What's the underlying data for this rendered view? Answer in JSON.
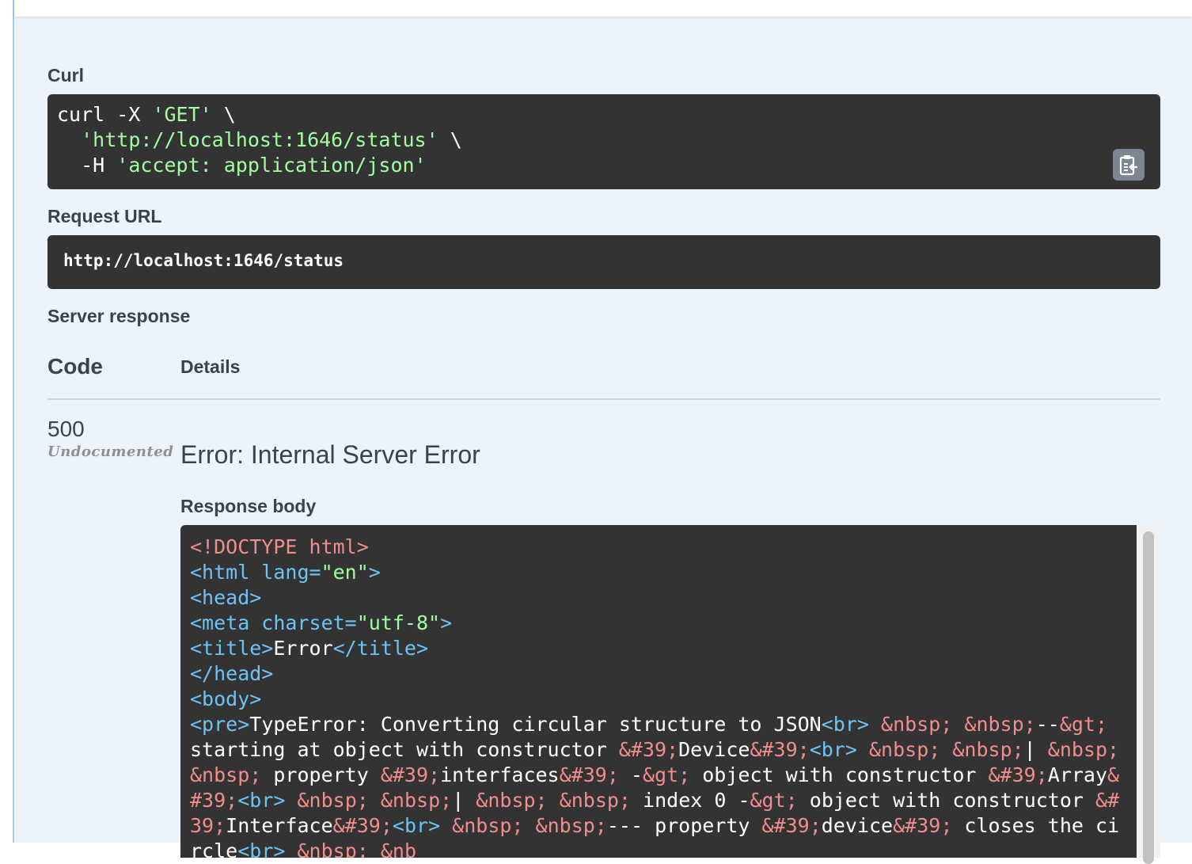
{
  "curl": {
    "label": "Curl",
    "line1_cmd": "curl -X ",
    "line1_method": "'GET'",
    "line1_tail": " \\",
    "line2_indent": "  ",
    "line2_url": "'http://localhost:1646/status'",
    "line2_tail": " \\",
    "line3_flag": "  -H ",
    "line3_header": "'accept: application/json'",
    "copy_icon": "copy-to-clipboard-icon"
  },
  "request_url": {
    "label": "Request URL",
    "value": "http://localhost:1646/status"
  },
  "server_response": {
    "label": "Server response",
    "col_code": "Code",
    "col_details": "Details",
    "code": "500",
    "code_note": "Undocumented",
    "error_title": "Error: Internal Server Error",
    "body_label": "Response body",
    "body_tokens": [
      {
        "k": "doc",
        "t": "<!DOCTYPE html>"
      },
      {
        "k": "txt",
        "t": "\n"
      },
      {
        "k": "tag",
        "t": "<html lang="
      },
      {
        "k": "str",
        "t": "\"en\""
      },
      {
        "k": "tag",
        "t": ">"
      },
      {
        "k": "txt",
        "t": "\n"
      },
      {
        "k": "tag",
        "t": "<head>"
      },
      {
        "k": "txt",
        "t": "\n"
      },
      {
        "k": "tag",
        "t": "<meta charset="
      },
      {
        "k": "str",
        "t": "\"utf-8\""
      },
      {
        "k": "tag",
        "t": ">"
      },
      {
        "k": "txt",
        "t": "\n"
      },
      {
        "k": "tag",
        "t": "<title>"
      },
      {
        "k": "txt",
        "t": "Error"
      },
      {
        "k": "tag",
        "t": "</title>"
      },
      {
        "k": "txt",
        "t": "\n"
      },
      {
        "k": "tag",
        "t": "</head>"
      },
      {
        "k": "txt",
        "t": "\n"
      },
      {
        "k": "tag",
        "t": "<body>"
      },
      {
        "k": "txt",
        "t": "\n"
      },
      {
        "k": "tag",
        "t": "<pre>"
      },
      {
        "k": "txt",
        "t": "TypeError: Converting circular structure to JSON"
      },
      {
        "k": "tag",
        "t": "<br>"
      },
      {
        "k": "txt",
        "t": " "
      },
      {
        "k": "ent",
        "t": "&nbsp;"
      },
      {
        "k": "txt",
        "t": " "
      },
      {
        "k": "ent",
        "t": "&nbsp;"
      },
      {
        "k": "txt",
        "t": "--"
      },
      {
        "k": "ent",
        "t": "&gt;"
      },
      {
        "k": "txt",
        "t": " starting at object with constructor "
      },
      {
        "k": "ent",
        "t": "&#39;"
      },
      {
        "k": "txt",
        "t": "Device"
      },
      {
        "k": "ent",
        "t": "&#39;"
      },
      {
        "k": "tag",
        "t": "<br>"
      },
      {
        "k": "txt",
        "t": " "
      },
      {
        "k": "ent",
        "t": "&nbsp;"
      },
      {
        "k": "txt",
        "t": " "
      },
      {
        "k": "ent",
        "t": "&nbsp;"
      },
      {
        "k": "txt",
        "t": "| "
      },
      {
        "k": "ent",
        "t": "&nbsp;"
      },
      {
        "k": "txt",
        "t": " "
      },
      {
        "k": "ent",
        "t": "&nbsp;"
      },
      {
        "k": "txt",
        "t": " property "
      },
      {
        "k": "ent",
        "t": "&#39;"
      },
      {
        "k": "txt",
        "t": "interfaces"
      },
      {
        "k": "ent",
        "t": "&#39;"
      },
      {
        "k": "txt",
        "t": " -"
      },
      {
        "k": "ent",
        "t": "&gt;"
      },
      {
        "k": "txt",
        "t": " object with constructor "
      },
      {
        "k": "ent",
        "t": "&#39;"
      },
      {
        "k": "txt",
        "t": "Array"
      },
      {
        "k": "ent",
        "t": "&#39;"
      },
      {
        "k": "tag",
        "t": "<br>"
      },
      {
        "k": "txt",
        "t": " "
      },
      {
        "k": "ent",
        "t": "&nbsp;"
      },
      {
        "k": "txt",
        "t": " "
      },
      {
        "k": "ent",
        "t": "&nbsp;"
      },
      {
        "k": "txt",
        "t": "| "
      },
      {
        "k": "ent",
        "t": "&nbsp;"
      },
      {
        "k": "txt",
        "t": " "
      },
      {
        "k": "ent",
        "t": "&nbsp;"
      },
      {
        "k": "txt",
        "t": " index 0 -"
      },
      {
        "k": "ent",
        "t": "&gt;"
      },
      {
        "k": "txt",
        "t": " object with constructor "
      },
      {
        "k": "ent",
        "t": "&#39;"
      },
      {
        "k": "txt",
        "t": "Interface"
      },
      {
        "k": "ent",
        "t": "&#39;"
      },
      {
        "k": "tag",
        "t": "<br>"
      },
      {
        "k": "txt",
        "t": " "
      },
      {
        "k": "ent",
        "t": "&nbsp;"
      },
      {
        "k": "txt",
        "t": " "
      },
      {
        "k": "ent",
        "t": "&nbsp;"
      },
      {
        "k": "txt",
        "t": "--- property "
      },
      {
        "k": "ent",
        "t": "&#39;"
      },
      {
        "k": "txt",
        "t": "device"
      },
      {
        "k": "ent",
        "t": "&#39;"
      },
      {
        "k": "txt",
        "t": " closes the circle"
      },
      {
        "k": "tag",
        "t": "<br>"
      },
      {
        "k": "txt",
        "t": " "
      },
      {
        "k": "ent",
        "t": "&nbsp;"
      },
      {
        "k": "txt",
        "t": " "
      },
      {
        "k": "ent",
        "t": "&nb"
      }
    ]
  }
}
